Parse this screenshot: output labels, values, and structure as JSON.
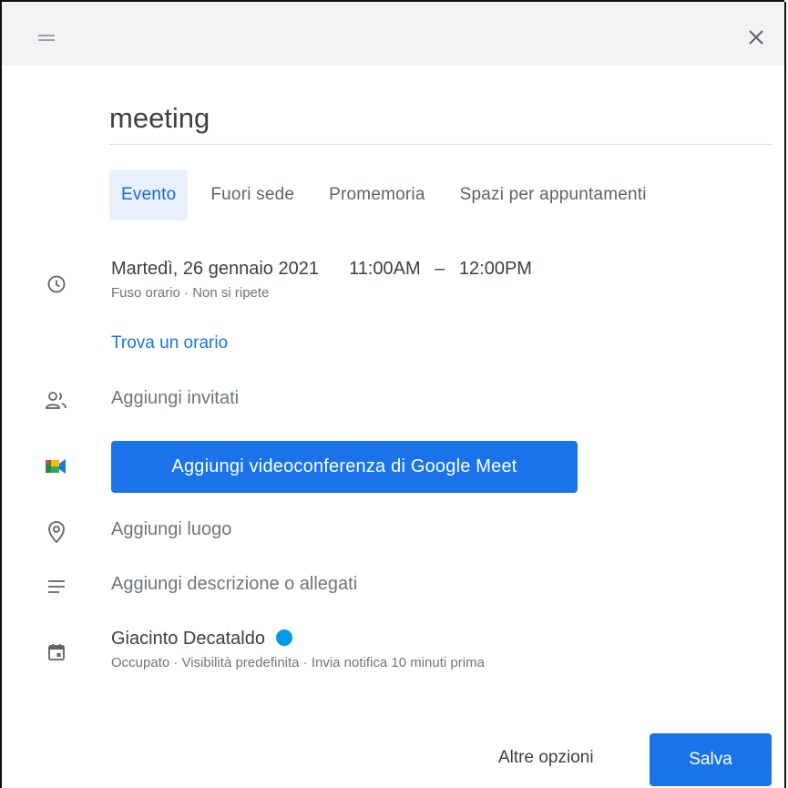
{
  "dialog": {
    "title": "meeting",
    "tabs": [
      {
        "label": "Evento",
        "active": true
      },
      {
        "label": "Fuori sede",
        "active": false
      },
      {
        "label": "Promemoria",
        "active": false
      },
      {
        "label": "Spazi per appuntamenti",
        "active": false
      }
    ],
    "datetime": {
      "date": "Martedì, 26 gennaio 2021",
      "start": "11:00AM",
      "dash": "–",
      "end": "12:00PM",
      "sub": "Fuso orario · Non si ripete"
    },
    "find_time": "Trova un orario",
    "guests_placeholder": "Aggiungi invitati",
    "meet_button": "Aggiungi videoconferenza di Google Meet",
    "location_placeholder": "Aggiungi luogo",
    "description_placeholder": "Aggiungi descrizione o allegati",
    "calendar": {
      "owner": "Giacinto Decataldo",
      "color": "#039be5",
      "sub": "Occupato · Visibilità predefinita · Invia notifica 10 minuti prima"
    },
    "more_options": "Altre opzioni",
    "save": "Salva"
  },
  "colors": {
    "accent": "#1a73e8",
    "tab_active_bg": "#e8f0fe",
    "topbar_bg": "#f1f3f4"
  },
  "icons": {
    "drag": "drag-handle-icon",
    "close": "close-icon",
    "time": "clock-icon",
    "guests": "people-icon",
    "meet": "google-meet-icon",
    "location": "location-pin-icon",
    "description": "notes-icon",
    "calendar": "calendar-icon"
  }
}
